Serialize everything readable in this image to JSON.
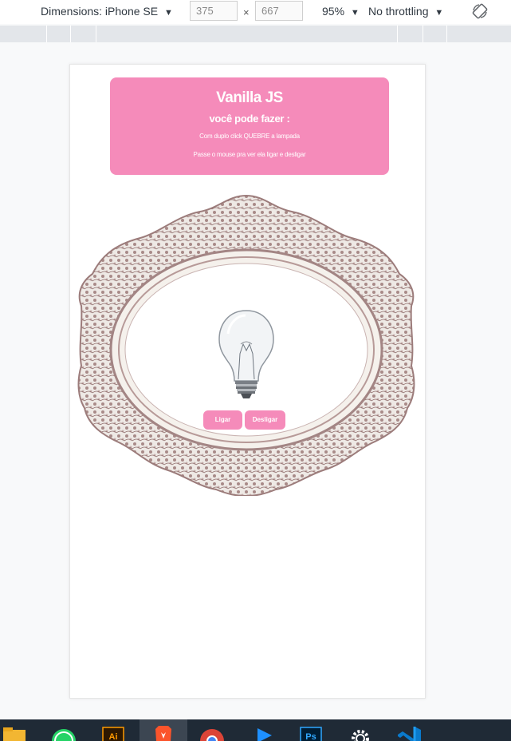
{
  "devtools": {
    "device_label": "Dimensions: iPhone SE",
    "width_value": "375",
    "height_value": "667",
    "times": "×",
    "zoom": "95%",
    "throttling": "No throttling",
    "caret": "▼"
  },
  "app": {
    "title": "Vanilla JS",
    "subtitle": "você pode fazer :",
    "instruction_1": "Com duplo click QUEBRE a lampada",
    "instruction_2": "Passe o mouse pra ver ela ligar e desligar",
    "button_on": "Ligar",
    "button_off": "Desligar",
    "accent_color": "#f58bba"
  },
  "taskbar": {
    "apps": [
      "file-explorer-icon",
      "whatsapp-icon",
      "illustrator-icon",
      "brave-icon",
      "chrome-icon",
      "media-player-icon",
      "photoshop-icon",
      "settings-icon",
      "vscode-icon"
    ]
  }
}
